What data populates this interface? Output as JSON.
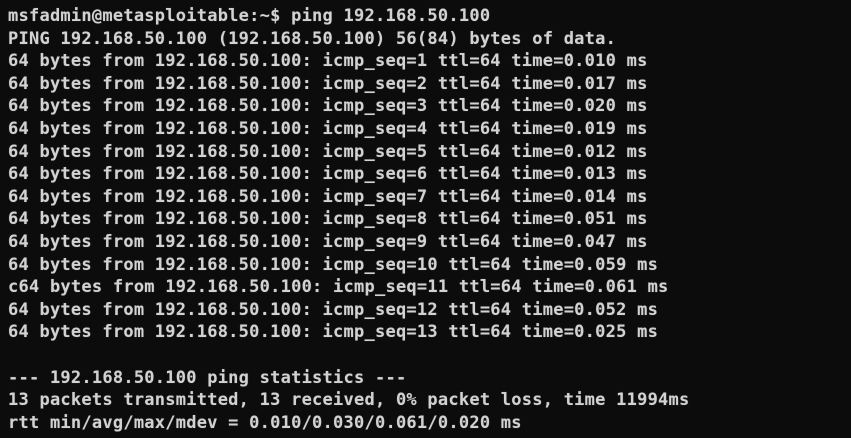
{
  "terminal": {
    "prompt_line": "msfadmin@metasploitable:~$ ping 192.168.50.100",
    "header_line": "PING 192.168.50.100 (192.168.50.100) 56(84) bytes of data.",
    "replies": [
      "64 bytes from 192.168.50.100: icmp_seq=1 ttl=64 time=0.010 ms",
      "64 bytes from 192.168.50.100: icmp_seq=2 ttl=64 time=0.017 ms",
      "64 bytes from 192.168.50.100: icmp_seq=3 ttl=64 time=0.020 ms",
      "64 bytes from 192.168.50.100: icmp_seq=4 ttl=64 time=0.019 ms",
      "64 bytes from 192.168.50.100: icmp_seq=5 ttl=64 time=0.012 ms",
      "64 bytes from 192.168.50.100: icmp_seq=6 ttl=64 time=0.013 ms",
      "64 bytes from 192.168.50.100: icmp_seq=7 ttl=64 time=0.014 ms",
      "64 bytes from 192.168.50.100: icmp_seq=8 ttl=64 time=0.051 ms",
      "64 bytes from 192.168.50.100: icmp_seq=9 ttl=64 time=0.047 ms",
      "64 bytes from 192.168.50.100: icmp_seq=10 ttl=64 time=0.059 ms",
      "c64 bytes from 192.168.50.100: icmp_seq=11 ttl=64 time=0.061 ms",
      "64 bytes from 192.168.50.100: icmp_seq=12 ttl=64 time=0.052 ms",
      "64 bytes from 192.168.50.100: icmp_seq=13 ttl=64 time=0.025 ms"
    ],
    "stats_header": "--- 192.168.50.100 ping statistics ---",
    "stats_packets": "13 packets transmitted, 13 received, 0% packet loss, time 11994ms",
    "stats_rtt": "rtt min/avg/max/mdev = 0.010/0.030/0.061/0.020 ms"
  },
  "colors": {
    "background": "#0c0c0c",
    "foreground": "#d2d2d2"
  }
}
